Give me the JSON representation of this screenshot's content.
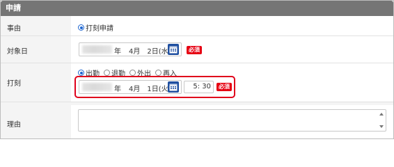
{
  "header": {
    "title": "申請"
  },
  "reason_type": {
    "label": "事由",
    "option": "打刻申請"
  },
  "target_date": {
    "label": "対象日",
    "year_suffix": "年",
    "month_day": "4月　2日(水)",
    "required": "必須"
  },
  "stamp": {
    "label": "打刻",
    "options": [
      "出勤",
      "退勤",
      "外出",
      "再入"
    ],
    "selected": "出勤",
    "year_suffix": "年",
    "month_day": "4月　1日(火)",
    "time": "5: 30",
    "required": "必須"
  },
  "reason": {
    "label": "理由",
    "value": ""
  },
  "colors": {
    "header_bg": "#757575",
    "calendar_button": "#1f4fa0",
    "required_badge": "#e60012",
    "highlight_border": "#e0001b",
    "radio_selected": "#1e66d0"
  }
}
